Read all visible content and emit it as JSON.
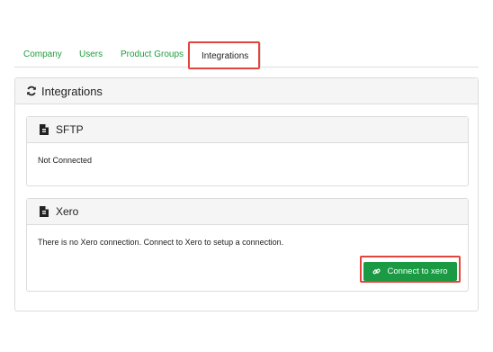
{
  "tabs": [
    {
      "label": "Company"
    },
    {
      "label": "Users"
    },
    {
      "label": "Product Groups"
    },
    {
      "label": "Integrations"
    }
  ],
  "panel": {
    "title": "Integrations",
    "icon": "refresh-icon"
  },
  "sftp": {
    "title": "SFTP",
    "icon": "file-icon",
    "status": "Not Connected"
  },
  "xero": {
    "title": "Xero",
    "icon": "file-icon",
    "message": "There is no Xero connection. Connect to Xero to setup a connection.",
    "button_label": "Connect to xero",
    "button_icon": "link-icon"
  },
  "colors": {
    "accent": "#1f9d3c",
    "button": "#1a9a43",
    "highlight": "#e2453b"
  }
}
